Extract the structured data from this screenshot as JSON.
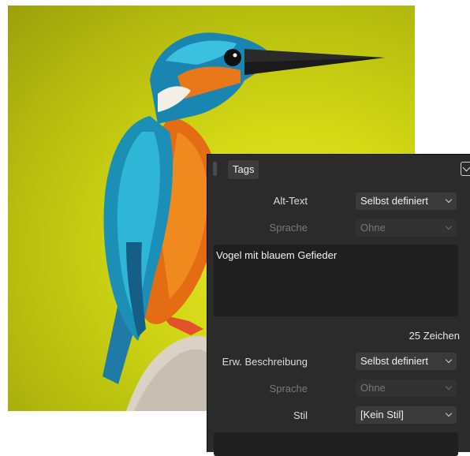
{
  "image": {
    "subject": "kingfisher-photo"
  },
  "panel": {
    "tab_label": "Tags",
    "alt_text": {
      "label": "Alt-Text",
      "mode": "Selbst definiert",
      "language_label": "Sprache",
      "language_value": "Ohne",
      "text": "Vogel mit blauem Gefieder",
      "char_count": "25 Zeichen"
    },
    "extended": {
      "label": "Erw. Beschreibung",
      "mode": "Selbst definiert",
      "language_label": "Sprache",
      "language_value": "Ohne",
      "style_label": "Stil",
      "style_value": "[Kein Stil]"
    }
  },
  "colors": {
    "panel_bg": "#2b2b2b",
    "field_bg": "#1f1f1f"
  }
}
